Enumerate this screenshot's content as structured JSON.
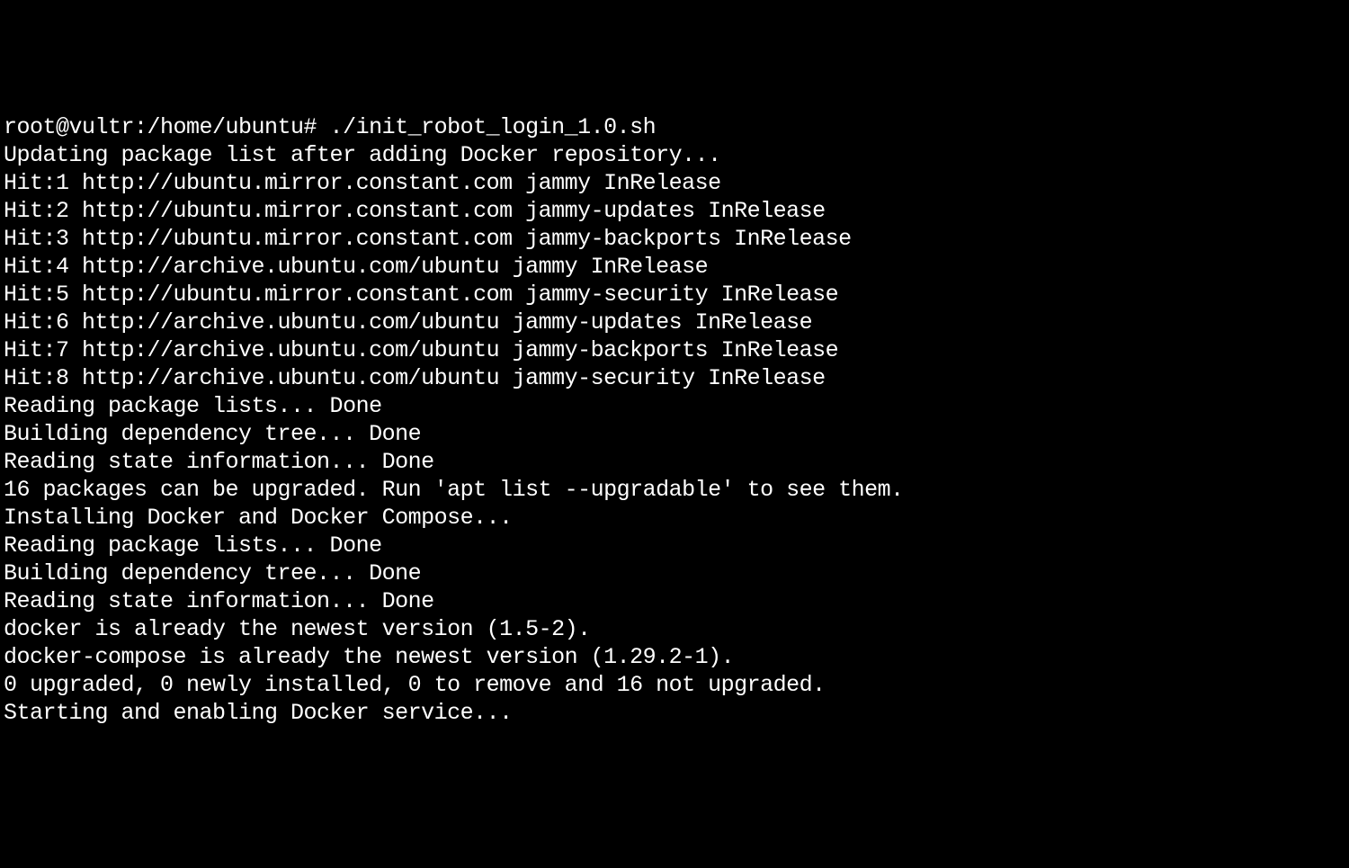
{
  "terminal": {
    "lines": [
      "root@vultr:/home/ubuntu# ./init_robot_login_1.0.sh",
      "Updating package list after adding Docker repository...",
      "Hit:1 http://ubuntu.mirror.constant.com jammy InRelease",
      "Hit:2 http://ubuntu.mirror.constant.com jammy-updates InRelease",
      "Hit:3 http://ubuntu.mirror.constant.com jammy-backports InRelease",
      "Hit:4 http://archive.ubuntu.com/ubuntu jammy InRelease",
      "Hit:5 http://ubuntu.mirror.constant.com jammy-security InRelease",
      "Hit:6 http://archive.ubuntu.com/ubuntu jammy-updates InRelease",
      "Hit:7 http://archive.ubuntu.com/ubuntu jammy-backports InRelease",
      "Hit:8 http://archive.ubuntu.com/ubuntu jammy-security InRelease",
      "Reading package lists... Done",
      "Building dependency tree... Done",
      "Reading state information... Done",
      "16 packages can be upgraded. Run 'apt list --upgradable' to see them.",
      "Installing Docker and Docker Compose...",
      "Reading package lists... Done",
      "Building dependency tree... Done",
      "Reading state information... Done",
      "docker is already the newest version (1.5-2).",
      "docker-compose is already the newest version (1.29.2-1).",
      "0 upgraded, 0 newly installed, 0 to remove and 16 not upgraded.",
      "Starting and enabling Docker service..."
    ]
  }
}
